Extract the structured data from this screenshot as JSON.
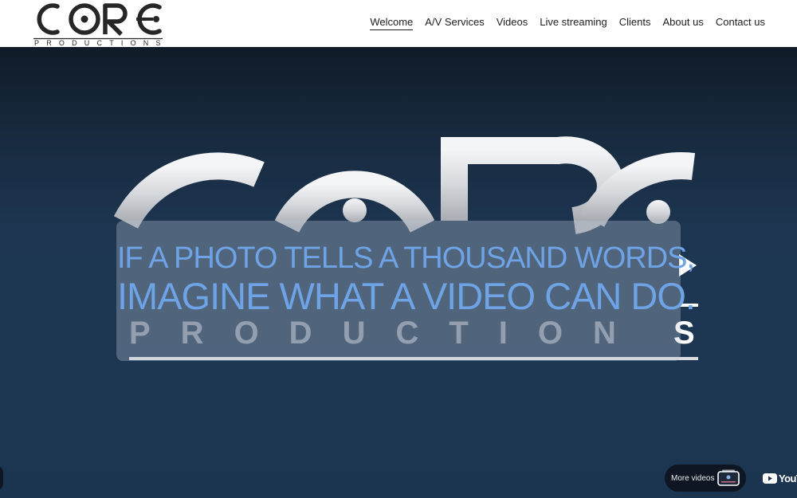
{
  "brand": {
    "name": "CORE",
    "sub": "PRODUCTIONS"
  },
  "nav": {
    "items": [
      {
        "label": "Welcome",
        "active": true
      },
      {
        "label": "A/V Services"
      },
      {
        "label": "Videos"
      },
      {
        "label": "Live streaming"
      },
      {
        "label": "Clients"
      },
      {
        "label": "About us"
      },
      {
        "label": "Contact us"
      }
    ]
  },
  "hero": {
    "tagline_line1": "IF A PHOTO TELLS A THOUSAND WORDS,",
    "tagline_line2": "IMAGINE WHAT A VIDEO CAN DO."
  },
  "controls": {
    "more_videos_label": "More videos",
    "youtube_label": "YouTube"
  },
  "colors": {
    "tagline": "#6ea3e6",
    "hero_bg": "#1d3550",
    "nav_text": "#1f1f1f"
  },
  "icons": [
    "core-productions-logo",
    "youtube-icon",
    "video-thumbnail-icon"
  ]
}
